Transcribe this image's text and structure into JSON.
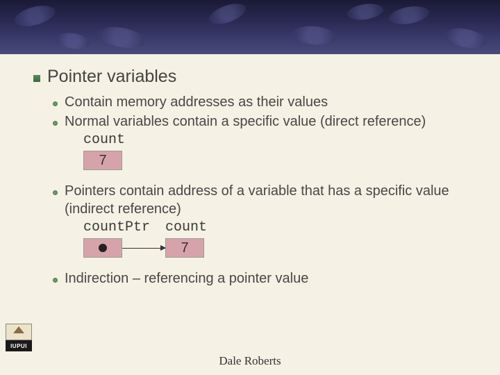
{
  "banner": {},
  "heading": "Pointer variables",
  "bullets": {
    "b1": "Contain memory addresses as their values",
    "b2": "Normal variables contain a specific value (direct reference)",
    "countLabel": "count",
    "countValue": "7",
    "b3": "Pointers contain address of a variable that has a specific value (indirect reference)",
    "ptrLabel": "countPtr",
    "ptrTargetLabel": "count",
    "ptrTargetValue": "7",
    "b4": "Indirection – referencing a pointer value"
  },
  "footer": {
    "author": "Dale Roberts",
    "logoText": "IUPUI"
  }
}
